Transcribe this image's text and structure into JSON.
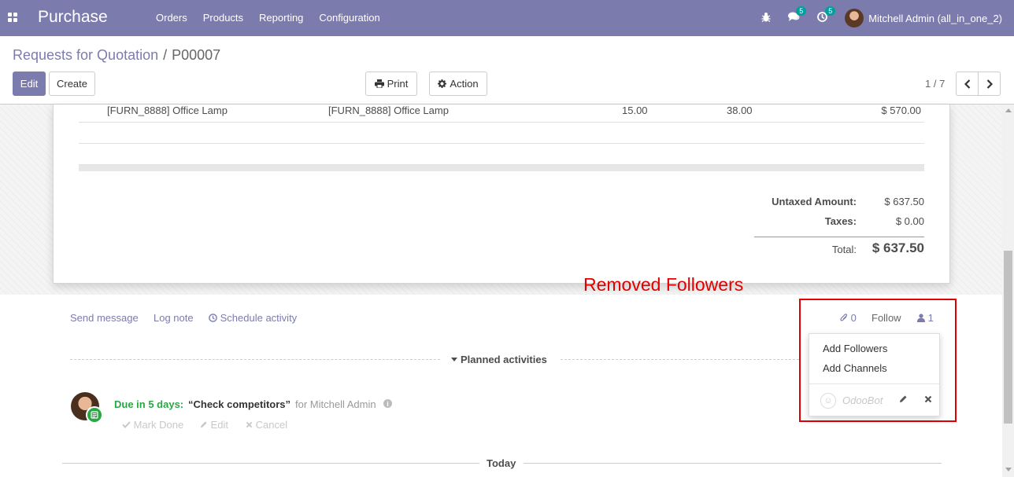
{
  "navbar": {
    "brand": "Purchase",
    "menu": [
      "Orders",
      "Products",
      "Reporting",
      "Configuration"
    ],
    "messages_count": "5",
    "activities_count": "5",
    "user": "Mitchell Admin (all_in_one_2)",
    "bg_color": "#7c7bad"
  },
  "breadcrumb": {
    "parent": "Requests for Quotation",
    "separator": "/",
    "current": "P00007"
  },
  "buttons": {
    "edit": "Edit",
    "create": "Create",
    "print": "Print",
    "action": "Action"
  },
  "pager": {
    "value": "1 / 7"
  },
  "order_line": {
    "product": "[FURN_8888] Office Lamp",
    "description": "[FURN_8888] Office Lamp",
    "quantity": "15.00",
    "unit_price": "38.00",
    "subtotal": "$ 570.00"
  },
  "totals": {
    "untaxed_label": "Untaxed Amount:",
    "untaxed_value": "$ 637.50",
    "taxes_label": "Taxes:",
    "taxes_value": "$ 0.00",
    "total_label": "Total:",
    "total_value": "$ 637.50"
  },
  "annotation": {
    "text": "Removed Followers",
    "color": "#e00000"
  },
  "chatter": {
    "send_message": "Send message",
    "log_note": "Log note",
    "schedule_activity": "Schedule activity",
    "attachments_count": "0",
    "follow": "Follow",
    "followers_count": "1"
  },
  "followers_dropdown": {
    "add_followers": "Add Followers",
    "add_channels": "Add Channels",
    "follower_name": "OdooBot"
  },
  "activities": {
    "section_title": "Planned activities",
    "due": "Due in 5 days:",
    "summary": "“Check competitors”",
    "assigned": "for Mitchell Admin",
    "mark_done": "Mark Done",
    "edit": "Edit",
    "cancel": "Cancel"
  },
  "timeline": {
    "today": "Today"
  }
}
